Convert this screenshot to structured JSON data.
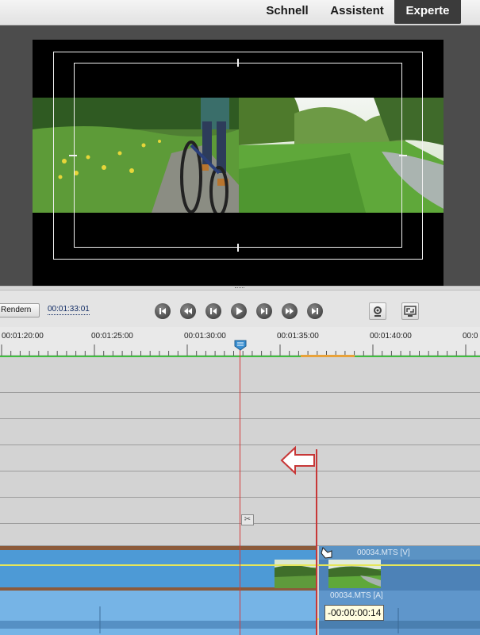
{
  "modes": {
    "quick": "Schnell",
    "guided": "Assistent",
    "expert": "Experte",
    "active": "Experte"
  },
  "transport": {
    "render_label": "Rendern",
    "timecode": "00:01:33:01",
    "buttons": [
      "go-to-start-icon",
      "step-back-icon",
      "frame-back-icon",
      "play-icon",
      "frame-forward-icon",
      "step-forward-icon",
      "go-to-end-icon"
    ],
    "right_icons": [
      "monitor-settings-icon",
      "fullscreen-icon"
    ]
  },
  "ruler": {
    "labels": [
      "00:01:20:00",
      "00:01:25:00",
      "00:01:30:00",
      "00:01:35:00",
      "00:01:40:00",
      "00:0"
    ]
  },
  "timeline": {
    "video_clip_label": "00034.MTS [V]",
    "audio_clip_label": "00034.MTS [A]",
    "drag_offset_tooltip": "-00:00:00:14"
  },
  "colors": {
    "video_clip": "#4d9ad6",
    "audio_clip": "#76b4e6",
    "clip_band": "#8c5a3a",
    "playhead": "#d23b3b",
    "active_tab": "#3b3b3b"
  }
}
